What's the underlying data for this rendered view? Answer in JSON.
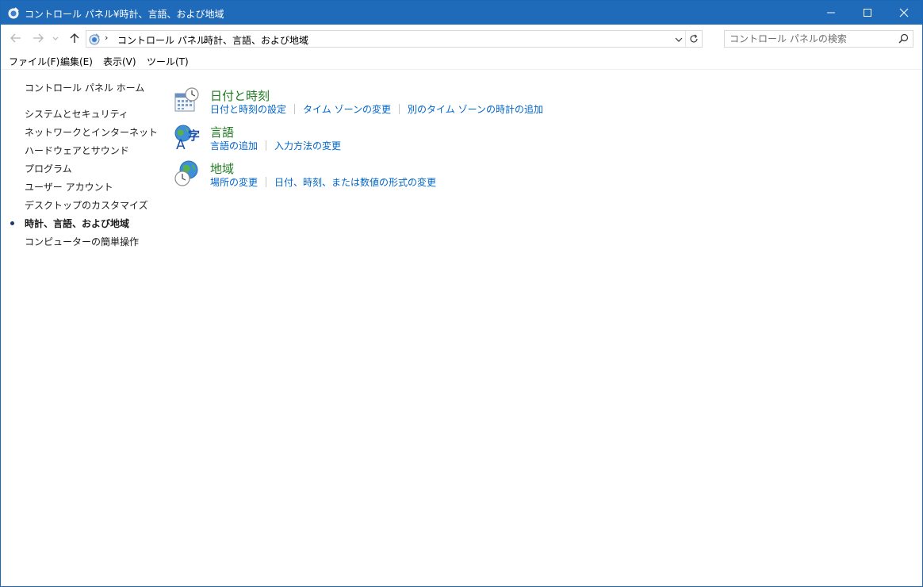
{
  "window": {
    "title": "コントロール パネル¥時計、言語、および地域"
  },
  "address": {
    "crumbs": [
      "コントロール パネル",
      "時計、言語、および地域"
    ]
  },
  "search": {
    "placeholder": "コントロール パネルの検索"
  },
  "menu": {
    "items": [
      "ファイル(F)",
      "編集(E)",
      "表示(V)",
      "ツール(T)"
    ]
  },
  "sidebar": {
    "home": "コントロール パネル ホーム",
    "items": [
      {
        "label": "システムとセキュリティ"
      },
      {
        "label": "ネットワークとインターネット"
      },
      {
        "label": "ハードウェアとサウンド"
      },
      {
        "label": "プログラム"
      },
      {
        "label": "ユーザー アカウント"
      },
      {
        "label": "デスクトップのカスタマイズ"
      },
      {
        "label": "時計、言語、および地域",
        "current": true
      },
      {
        "label": "コンピューターの簡単操作"
      }
    ]
  },
  "categories": [
    {
      "title": "日付と時刻",
      "icon": "calendar-clock-icon",
      "links": [
        "日付と時刻の設定",
        "タイム ゾーンの変更",
        "別のタイム ゾーンの時計の追加"
      ]
    },
    {
      "title": "言語",
      "icon": "language-icon",
      "links": [
        "言語の追加",
        "入力方法の変更"
      ]
    },
    {
      "title": "地域",
      "icon": "globe-clock-icon",
      "links": [
        "場所の変更",
        "日付、時刻、または数値の形式の変更"
      ]
    }
  ],
  "colors": {
    "titlebar": "#1f6ab9",
    "category_title": "#1e7c1e",
    "link": "#0066cc"
  }
}
